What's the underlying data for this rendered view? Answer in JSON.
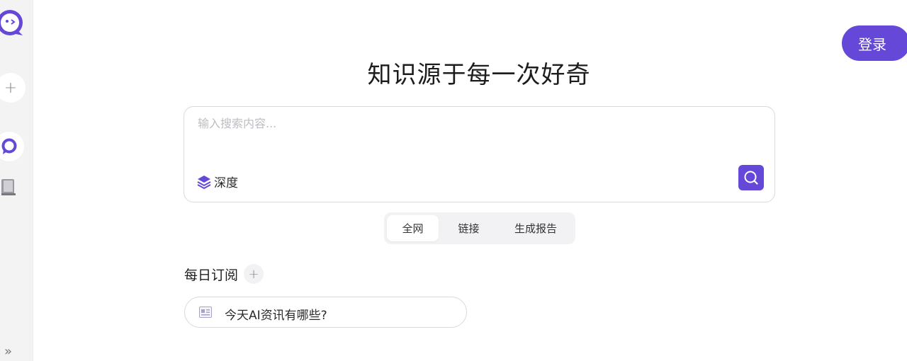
{
  "header": {
    "login_label": "登录"
  },
  "sidebar": {
    "new_icon": "plus-icon",
    "chat_icon": "chat-bubble-icon",
    "library_icon": "book-icon",
    "expand_icon": "double-chevron-right-icon"
  },
  "hero": {
    "title": "知识源于每一次好奇"
  },
  "search": {
    "placeholder": "输入搜索内容...",
    "value": "",
    "deep_label": "深度",
    "deep_icon": "layers-icon",
    "submit_icon": "search-icon"
  },
  "scopes": {
    "items": [
      {
        "label": "全网",
        "active": true
      },
      {
        "label": "链接",
        "active": false
      },
      {
        "label": "生成报告",
        "active": false
      }
    ]
  },
  "daily": {
    "title": "每日订阅",
    "add_icon": "plus-icon",
    "items": [
      {
        "icon": "newspaper-icon",
        "text": "今天AI资讯有哪些?"
      }
    ]
  },
  "colors": {
    "accent": "#6548d8"
  }
}
